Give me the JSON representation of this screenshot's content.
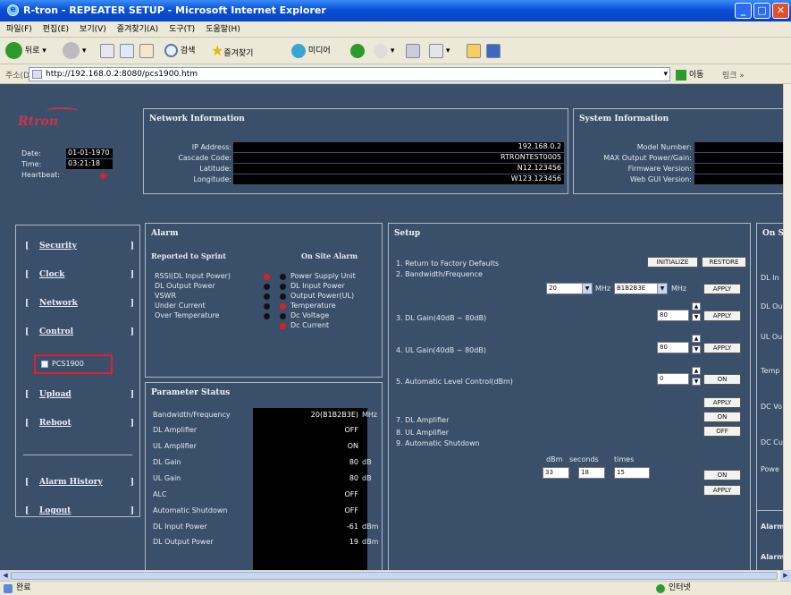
{
  "window": {
    "title": "R-tron - REPEATER SETUP - Microsoft Internet Explorer"
  },
  "menu": [
    "파일(F)",
    "편집(E)",
    "보기(V)",
    "즐겨찾기(A)",
    "도구(T)",
    "도움말(H)"
  ],
  "toolbar": {
    "back": "뒤로",
    "search": "검색",
    "favorites": "즐겨찾기",
    "media": "미디어"
  },
  "address": {
    "label": "주소(D)",
    "url": "http://192.168.0.2:8080/pcs1900.htm",
    "go": "이동",
    "links": "링크 »"
  },
  "brand": {
    "logo": "Rtron"
  },
  "device": {
    "date_label": "Date:",
    "date": "01-01-1970",
    "time_label": "Time:",
    "time": "03:21:18",
    "heartbeat_label": "Heartbeat:"
  },
  "network": {
    "title": "Network Information",
    "ip_label": "IP Address:",
    "ip": "192.168.0.2",
    "cascade_label": "Cascade Code:",
    "cascade": "RTRONTEST0005",
    "lat_label": "Latitude:",
    "lat": "N12.123456",
    "lon_label": "Longitude:",
    "lon": "W123.123456"
  },
  "system": {
    "title": "System Information",
    "model_label": "Model Number:",
    "maxpower_label": "MAX Output Power/Gain:",
    "fw_label": "Firmware Version:",
    "gui_label": "Web GUI Version:"
  },
  "nav": {
    "security": "Security",
    "clock": "Clock",
    "network": "Network",
    "control": "Control",
    "pcs": "PCS1900",
    "upload": "Upload",
    "reboot": "Reboot",
    "alarm_history": "Alarm History",
    "logout": "Logout"
  },
  "alarm": {
    "title": "Alarm",
    "reported_title": "Reported to Sprint",
    "onsite_title": "On Site Alarm",
    "reported": [
      "RSSI(DL Input Power)",
      "DL Output Power",
      "VSWR",
      "Under Current",
      "Over Temperature"
    ],
    "onsite": [
      "Power Supply Unit",
      "DL Input Power",
      "Output Power(UL)",
      "Temperature",
      "Dc Voltage",
      "Dc Current"
    ]
  },
  "param": {
    "title": "Parameter Status",
    "rows": [
      {
        "label": "Bandwidth/Frequency",
        "value": "20(B1B2B3E)",
        "unit": "MHz"
      },
      {
        "label": "DL Amplifier",
        "value": "OFF",
        "unit": ""
      },
      {
        "label": "UL Amplifier",
        "value": "ON",
        "unit": ""
      },
      {
        "label": "DL Gain",
        "value": "80",
        "unit": "dB"
      },
      {
        "label": "UL Gain",
        "value": "80",
        "unit": "dB"
      },
      {
        "label": "ALC",
        "value": "OFF",
        "unit": ""
      },
      {
        "label": "Automatic Shutdown",
        "value": "OFF",
        "unit": ""
      },
      {
        "label": "DL Input Power",
        "value": "-61",
        "unit": "dBm"
      },
      {
        "label": "DL Output Power",
        "value": "19",
        "unit": "dBm"
      }
    ]
  },
  "setup": {
    "title": "Setup",
    "item1": "1. Return to Factory Defaults",
    "initialize": "INITIALIZE",
    "restore": "RESTORE",
    "item2": "2. Bandwidth/Frequence",
    "bw": "20",
    "mhz1": "MHz",
    "freq": "B1B2B3E",
    "mhz2": "MHz",
    "item3": "3. DL Gain(40dB ~ 80dB)",
    "dl_gain": "80",
    "item4": "4. UL Gain(40dB ~ 80dB)",
    "ul_gain": "80",
    "item5": "5. Automatic Level Control(dBm)",
    "alc": "0",
    "item7": "7. DL Amplifier",
    "item8": "8. UL Amplifier",
    "item9": "9. Automatic Shutdown",
    "col_dbm": "dBm",
    "col_seconds": "seconds",
    "col_times": "times",
    "sd_dbm": "33",
    "sd_seconds": "18",
    "sd_times": "15",
    "apply": "APPLY",
    "on": "ON",
    "off": "OFF"
  },
  "onstatus": {
    "title": "On S",
    "items": [
      "DL In",
      "DL Ou",
      "UL Ou",
      "Temp",
      "DC Vo",
      "DC Cu",
      "Powe"
    ],
    "alarm1": "Alarm",
    "alarm2": "Alarm"
  },
  "status": {
    "left": "완료",
    "zone": "인터넷"
  }
}
